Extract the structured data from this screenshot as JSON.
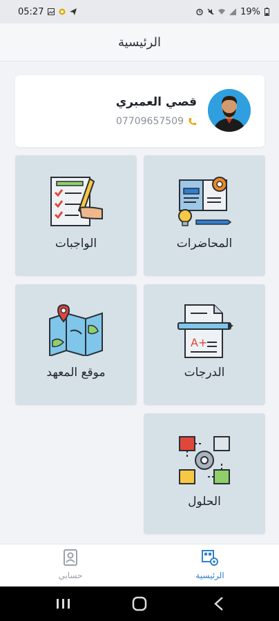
{
  "status_bar": {
    "time": "05:27",
    "battery": "19%"
  },
  "header": {
    "title": "الرئيسية"
  },
  "profile": {
    "name": "قصي العمبري",
    "phone": "07709657509"
  },
  "tiles": [
    {
      "label": "المحاضرات",
      "icon": "lectures-icon"
    },
    {
      "label": "الواجبات",
      "icon": "assignments-icon"
    },
    {
      "label": "الدرجات",
      "icon": "grades-icon"
    },
    {
      "label": "موقع المعهد",
      "icon": "institute-map-icon"
    },
    {
      "label": "الحلول",
      "icon": "solutions-puzzle-icon"
    }
  ],
  "bottom_nav": {
    "home_label": "الرئيسية",
    "account_label": "حسابي",
    "active": "home"
  },
  "colors": {
    "accent": "#2e7fd1",
    "tile_bg": "#d6e1e7",
    "phone_icon": "#f0a500"
  }
}
